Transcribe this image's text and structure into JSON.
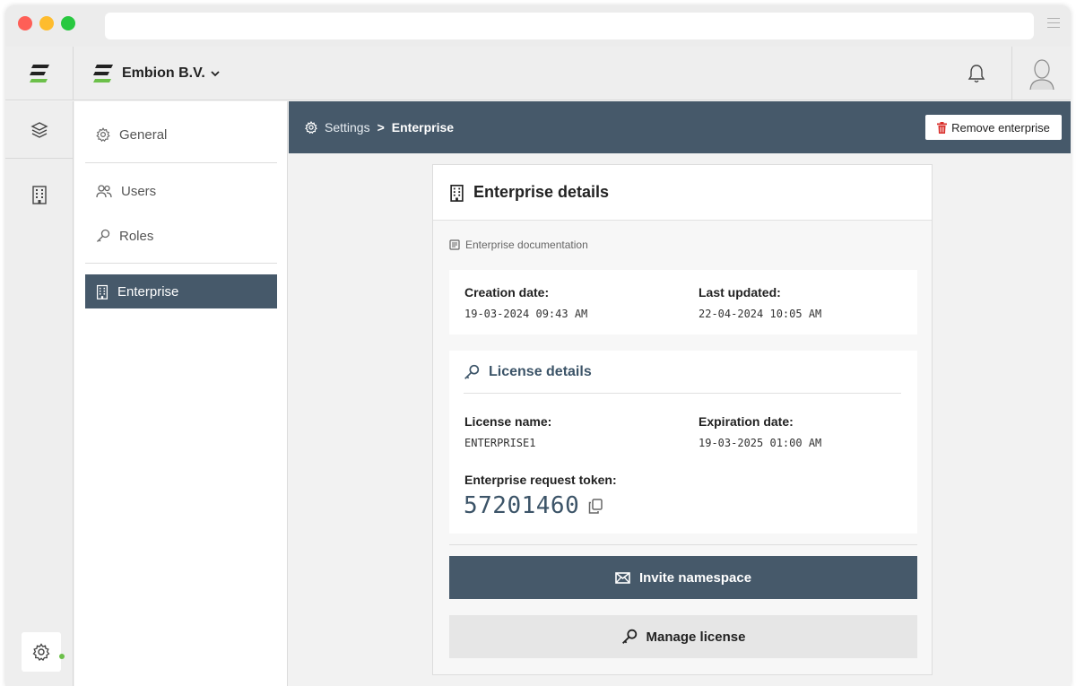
{
  "app": {
    "org_name": "Embion B.V."
  },
  "sidebar": {
    "items": [
      {
        "label": "General"
      },
      {
        "label": "Users"
      },
      {
        "label": "Roles"
      },
      {
        "label": "Enterprise"
      }
    ],
    "active": "Enterprise"
  },
  "breadcrumb": {
    "parent": "Settings",
    "separator": ">",
    "current": "Enterprise"
  },
  "actions": {
    "remove_label": "Remove enterprise"
  },
  "card": {
    "title": "Enterprise details",
    "doc_link": "Enterprise documentation",
    "creation_label": "Creation date:",
    "creation_value": "19-03-2024 09:43 AM",
    "updated_label": "Last updated:",
    "updated_value": "22-04-2024 10:05 AM"
  },
  "license": {
    "title": "License details",
    "name_label": "License name:",
    "name_value": "ENTERPRISE1",
    "expiration_label": "Expiration date:",
    "expiration_value": "19-03-2025 01:00 AM",
    "token_label": "Enterprise request token:",
    "token_value": "57201460"
  },
  "buttons": {
    "invite": "Invite namespace",
    "manage": "Manage license"
  },
  "colors": {
    "primary": "#46596a",
    "accent_green": "#6cc04a",
    "danger": "#d9302c"
  },
  "icons": {
    "logo": "embion-logo-icon",
    "bell": "bell-icon",
    "avatar": "user-avatar-icon",
    "layers": "layers-icon",
    "building": "building-icon",
    "gear": "gear-icon",
    "users": "users-icon",
    "key": "key-icon",
    "trash": "trash-icon",
    "book": "book-icon",
    "copy": "copy-icon",
    "mail": "mail-icon"
  }
}
